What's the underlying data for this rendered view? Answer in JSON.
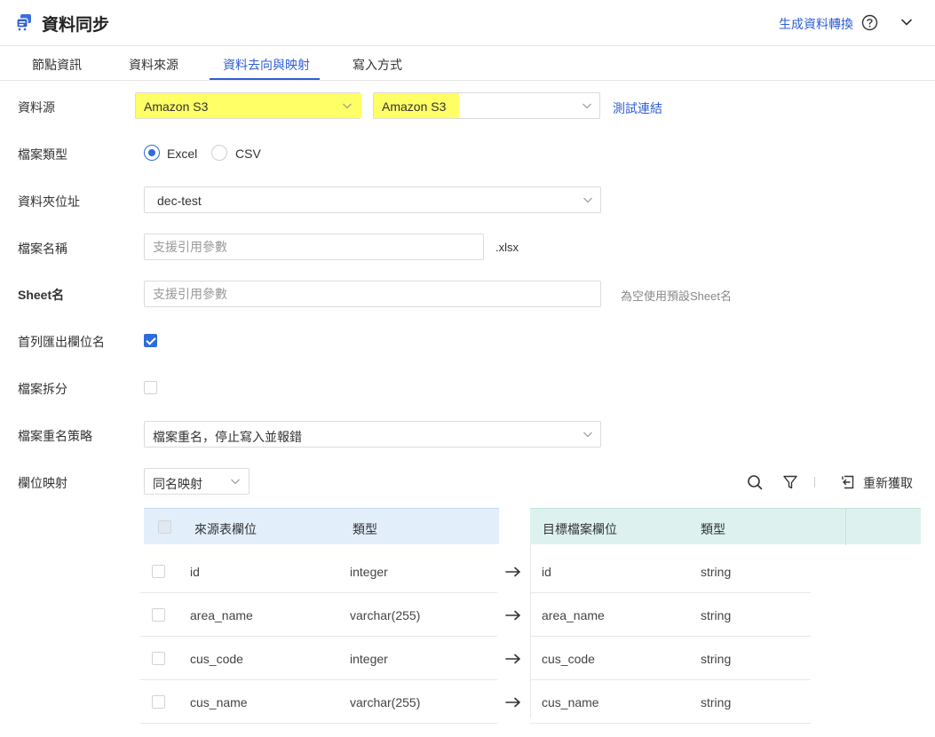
{
  "header": {
    "title": "資料同步",
    "generate_link": "生成資料轉換"
  },
  "tabs": [
    {
      "label": "節點資訊"
    },
    {
      "label": "資料來源"
    },
    {
      "label": "資料去向與映射"
    },
    {
      "label": "寫入方式"
    }
  ],
  "form": {
    "datasource": {
      "label": "資料源",
      "type_value": "Amazon S3",
      "conn_value": "Amazon S3",
      "test_link": "測試連結"
    },
    "file_type": {
      "label": "檔案類型",
      "options": [
        "Excel",
        "CSV"
      ],
      "selected": "Excel"
    },
    "folder": {
      "label": "資料夾位址",
      "value": "dec-test"
    },
    "file_name": {
      "label": "檔案名稱",
      "placeholder": "支援引用參數",
      "suffix": ".xlsx"
    },
    "sheet": {
      "label": "Sheet名",
      "placeholder": "支援引用參數",
      "hint": "為空使用預設Sheet名"
    },
    "first_row_header": {
      "label": "首列匯出欄位名",
      "checked": true
    },
    "file_split": {
      "label": "檔案拆分",
      "checked": false
    },
    "rename_policy": {
      "label": "檔案重名策略",
      "value": "檔案重名，停止寫入並報錯"
    },
    "mapping": {
      "label": "欄位映射",
      "mode": "同名映射",
      "refetch_label": "重新獲取"
    }
  },
  "table": {
    "source_headers": [
      "來源表欄位",
      "類型"
    ],
    "target_headers": [
      "目標檔案欄位",
      "類型"
    ],
    "rows": [
      {
        "src": "id",
        "src_type": "integer",
        "dst": "id",
        "dst_type": "string"
      },
      {
        "src": "area_name",
        "src_type": "varchar(255)",
        "dst": "area_name",
        "dst_type": "string"
      },
      {
        "src": "cus_code",
        "src_type": "integer",
        "dst": "cus_code",
        "dst_type": "string"
      },
      {
        "src": "cus_name",
        "src_type": "varchar(255)",
        "dst": "cus_name",
        "dst_type": "string"
      }
    ]
  },
  "colors": {
    "accent": "#2f5fd3",
    "highlight": "#ffff66"
  },
  "icons": {
    "app": "sync-icon",
    "help": "help-icon",
    "collapse": "chevron-down-icon",
    "search": "search-icon",
    "filter": "filter-icon",
    "refetch": "refetch-icon",
    "arrow": "arrow-right-icon"
  }
}
